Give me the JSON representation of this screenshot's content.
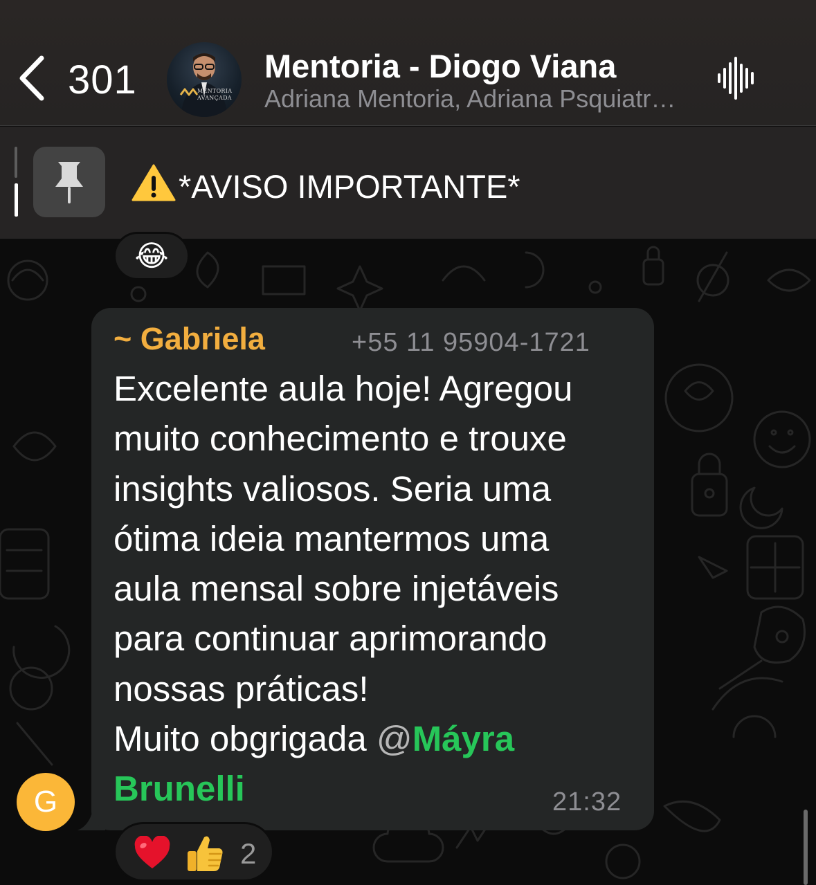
{
  "header": {
    "unread_count": "301",
    "chat_title": "Mentoria - Diogo Viana",
    "chat_subtitle": "Adriana Mentoria, Adriana Psquiatr…",
    "avatar_logo_text": "MENTORIA AVANÇADA",
    "back_icon": "chevron-left-icon",
    "call_icon": "voice-waveform-icon"
  },
  "pinned": {
    "icon": "pin-icon",
    "text": "*AVISO IMPORTANTE*",
    "prefix_icon": "warning-icon"
  },
  "previous_message": {
    "reaction": "😂"
  },
  "message": {
    "sender_name": "~ Gabriela",
    "sender_phone": "+55 11 95904-1721",
    "sender_initial": "G",
    "text_lines": [
      "Excelente aula hoje! Agregou",
      "muito conhecimento e trouxe",
      "insights valiosos. Seria uma",
      "ótima ideia mantermos uma",
      "aula mensal sobre injetáveis",
      "para continuar aprimorando",
      "nossas práticas!"
    ],
    "closing_text": "Muito obgrigada ",
    "mention_at": "@",
    "mention_name_part1": "Máyra",
    "mention_name_part2": "Brunelli",
    "time": "21:32",
    "reactions": [
      "❤️",
      "👍"
    ],
    "reaction_count": "2"
  },
  "colors": {
    "sender_name": "#f2ae3f",
    "mention": "#27c659",
    "bubble": "#242626",
    "avatar": "#fbb738"
  }
}
